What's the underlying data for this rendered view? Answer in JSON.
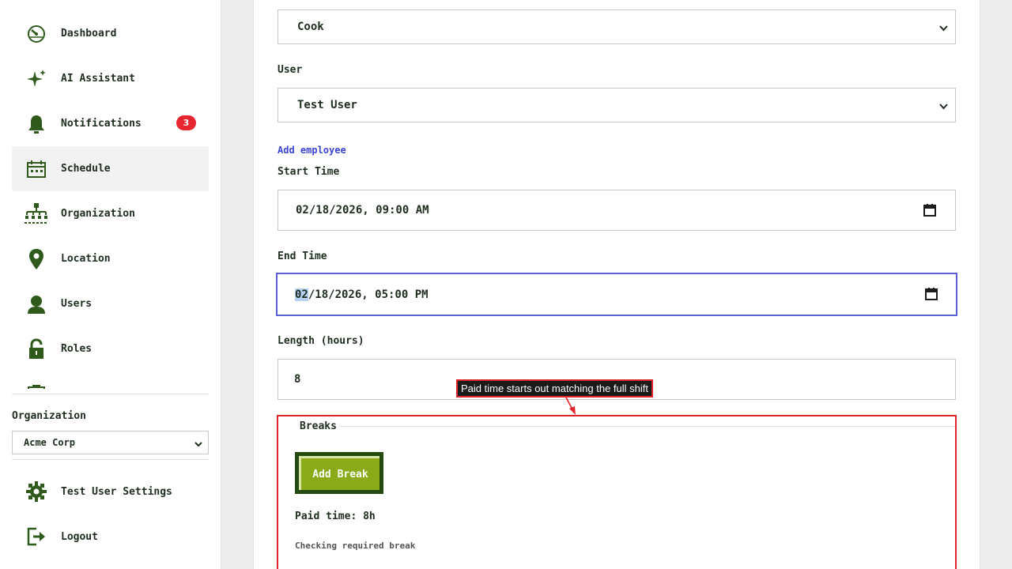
{
  "sidebar": {
    "items": [
      {
        "label": "Dashboard",
        "icon": "dashboard-icon"
      },
      {
        "label": "AI Assistant",
        "icon": "sparkle-icon"
      },
      {
        "label": "Notifications",
        "icon": "bell-icon",
        "badge": "3"
      },
      {
        "label": "Schedule",
        "icon": "calendar-icon",
        "active": true
      },
      {
        "label": "Organization",
        "icon": "org-chart-icon"
      },
      {
        "label": "Location",
        "icon": "map-pin-icon"
      },
      {
        "label": "Users",
        "icon": "user-icon"
      },
      {
        "label": "Roles",
        "icon": "lock-icon"
      }
    ],
    "organization": {
      "label": "Organization",
      "selected": "Acme Corp"
    },
    "footer": [
      {
        "label": "Test User Settings",
        "icon": "gear-icon"
      },
      {
        "label": "Logout",
        "icon": "logout-icon"
      }
    ]
  },
  "form": {
    "role_select": "Cook",
    "user": {
      "label": "User",
      "selected": "Test User"
    },
    "add_employee_link": "Add employee",
    "start_time": {
      "label": "Start Time",
      "month": "02",
      "rest": "/18/2026, 09:00 AM"
    },
    "end_time": {
      "label": "End Time",
      "month": "02",
      "rest": "/18/2026, 05:00 PM"
    },
    "length": {
      "label": "Length (hours)",
      "value": "8"
    },
    "breaks": {
      "legend": "Breaks",
      "add_break_label": "Add Break",
      "paid_time": "Paid time: 8h",
      "checking": "Checking required break"
    }
  },
  "annotation": {
    "tooltip": "Paid time starts out matching the full shift"
  },
  "colors": {
    "accent_green": "#2f5a1c",
    "button_green": "#8aaa19",
    "badge_red": "#e8262f",
    "link_blue": "#3b43d6",
    "focus_blue": "#5b5fd6",
    "annotation_red": "#e0262b"
  }
}
